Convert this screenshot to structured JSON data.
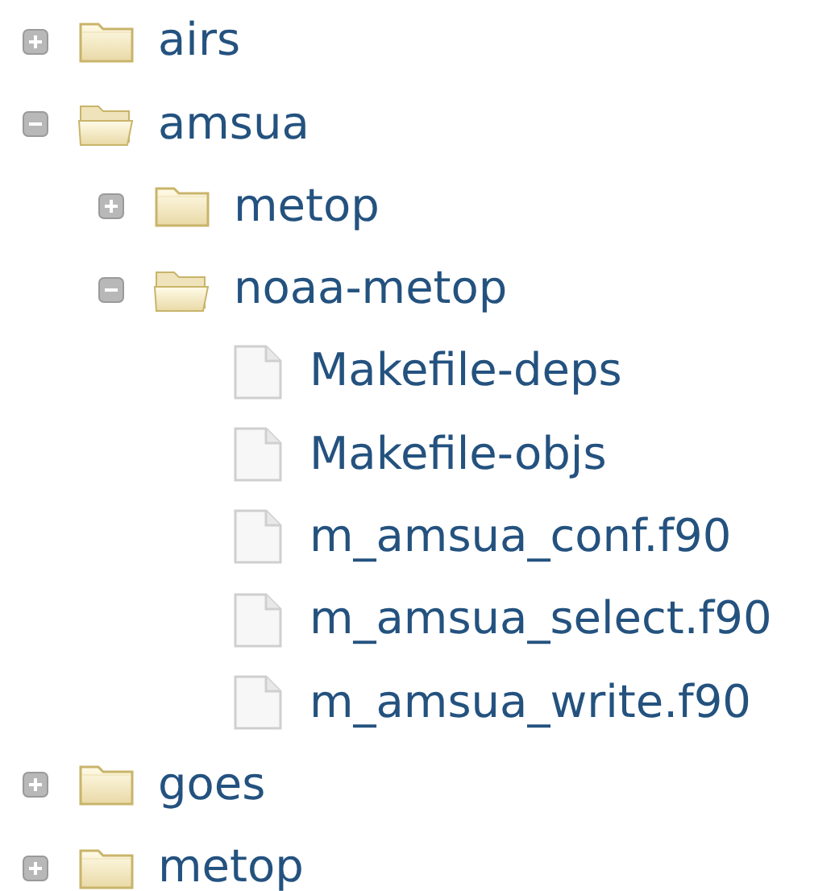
{
  "tree": [
    {
      "kind": "folder",
      "label": "airs",
      "expanded": false
    },
    {
      "kind": "folder",
      "label": "amsua",
      "expanded": true,
      "children": [
        {
          "kind": "folder",
          "label": "metop",
          "expanded": false
        },
        {
          "kind": "folder",
          "label": "noaa-metop",
          "expanded": true,
          "children": [
            {
              "kind": "file",
              "label": "Makefile-deps"
            },
            {
              "kind": "file",
              "label": "Makefile-objs"
            },
            {
              "kind": "file",
              "label": "m_amsua_conf.f90"
            },
            {
              "kind": "file",
              "label": "m_amsua_select.f90"
            },
            {
              "kind": "file",
              "label": "m_amsua_write.f90"
            }
          ]
        }
      ]
    },
    {
      "kind": "folder",
      "label": "goes",
      "expanded": false
    },
    {
      "kind": "folder",
      "label": "metop",
      "expanded": false
    }
  ]
}
